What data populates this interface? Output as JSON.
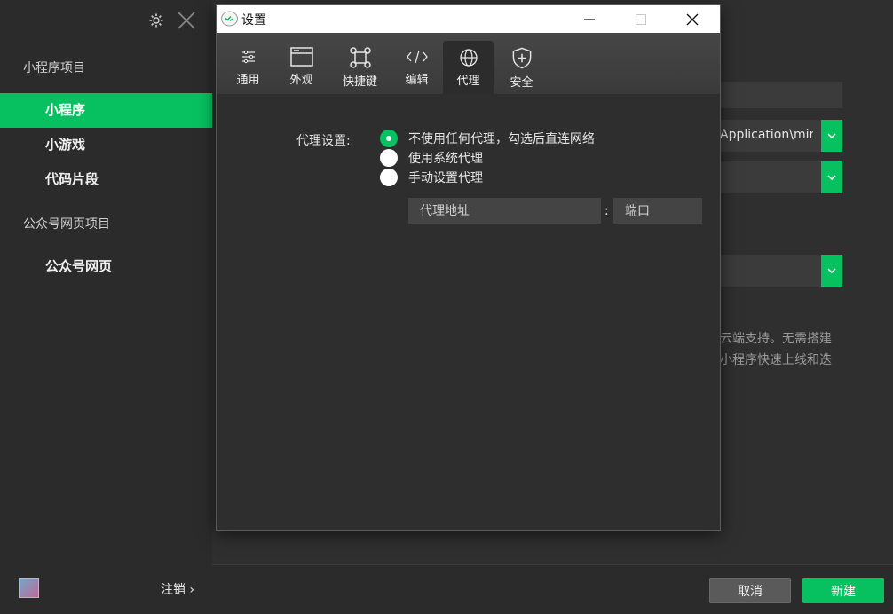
{
  "sidebar": {
    "section_mini": "小程序项目",
    "items": [
      {
        "label": "小程序"
      },
      {
        "label": "小游戏"
      },
      {
        "label": "代码片段"
      }
    ],
    "section_web": "公众号网页项目",
    "web_item": "公众号网页",
    "logout": "注销",
    "logout_chevron": "›"
  },
  "main": {
    "path_text": "Application\\mini|",
    "desc_line1": "云端支持。无需搭建",
    "desc_line2": "小程序快速上线和迭",
    "cancel": "取消",
    "create": "新建"
  },
  "dialog": {
    "title": "设置",
    "tabs": [
      {
        "label": "通用",
        "icon": "sliders-icon"
      },
      {
        "label": "外观",
        "icon": "window-icon"
      },
      {
        "label": "快捷键",
        "icon": "command-icon"
      },
      {
        "label": "编辑",
        "icon": "code-icon"
      },
      {
        "label": "代理",
        "icon": "globe-icon"
      },
      {
        "label": "安全",
        "icon": "shield-icon"
      }
    ],
    "active_tab": "代理",
    "proxy_label": "代理设置:",
    "options": [
      {
        "label": "不使用任何代理，勾选后直连网络",
        "checked": true
      },
      {
        "label": "使用系统代理",
        "checked": false
      },
      {
        "label": "手动设置代理",
        "checked": false
      }
    ],
    "address_placeholder": "代理地址",
    "colon": ":",
    "port_placeholder": "端口"
  },
  "colors": {
    "accent": "#07c160",
    "sidebar_bg": "#2b2b2b",
    "dialog_bg": "#2e2e2e"
  }
}
